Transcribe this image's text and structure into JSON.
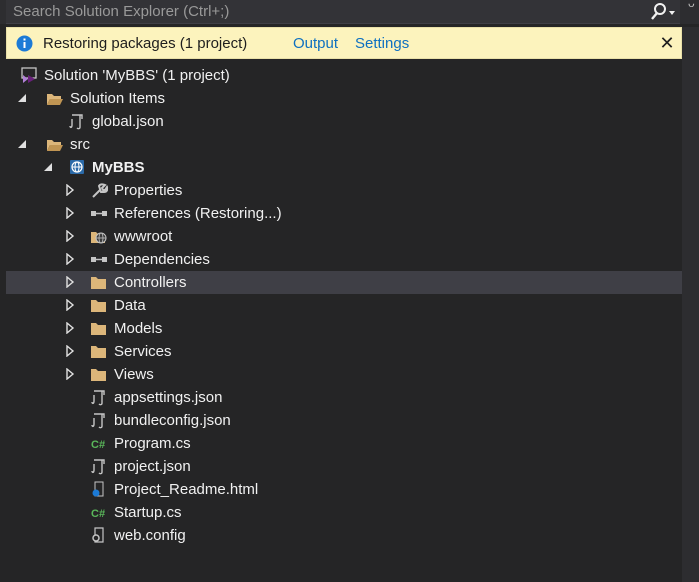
{
  "search": {
    "placeholder": "Search Solution Explorer (Ctrl+;)"
  },
  "infobar": {
    "message": "Restoring packages (1 project)",
    "links": [
      "Output",
      "Settings"
    ],
    "close": "✕"
  },
  "tree": [
    {
      "label": "Solution 'MyBBS' (1 project)",
      "icon": "solution-icon",
      "expander": "none"
    },
    {
      "label": "Solution Items",
      "icon": "folder-open-icon",
      "expander": "expanded"
    },
    {
      "label": "global.json",
      "icon": "json-file-icon",
      "expander": "none"
    },
    {
      "label": "src",
      "icon": "folder-open-icon",
      "expander": "expanded"
    },
    {
      "label": "MyBBS",
      "icon": "web-project-icon",
      "expander": "expanded",
      "bold": true
    },
    {
      "label": "Properties",
      "icon": "wrench-icon",
      "expander": "collapsed"
    },
    {
      "label": "References (Restoring...)",
      "icon": "references-icon",
      "expander": "collapsed"
    },
    {
      "label": "wwwroot",
      "icon": "globe-folder-icon",
      "expander": "collapsed"
    },
    {
      "label": "Dependencies",
      "icon": "references-icon",
      "expander": "collapsed"
    },
    {
      "label": "Controllers",
      "icon": "folder-icon",
      "expander": "collapsed",
      "selected": true
    },
    {
      "label": "Data",
      "icon": "folder-icon",
      "expander": "collapsed"
    },
    {
      "label": "Models",
      "icon": "folder-icon",
      "expander": "collapsed"
    },
    {
      "label": "Services",
      "icon": "folder-icon",
      "expander": "collapsed"
    },
    {
      "label": "Views",
      "icon": "folder-icon",
      "expander": "collapsed"
    },
    {
      "label": "appsettings.json",
      "icon": "json-file-icon",
      "expander": "none"
    },
    {
      "label": "bundleconfig.json",
      "icon": "json-file-icon",
      "expander": "none"
    },
    {
      "label": "Program.cs",
      "icon": "csharp-file-icon",
      "expander": "none"
    },
    {
      "label": "project.json",
      "icon": "json-file-icon",
      "expander": "none"
    },
    {
      "label": "Project_Readme.html",
      "icon": "html-file-icon",
      "expander": "none"
    },
    {
      "label": "Startup.cs",
      "icon": "csharp-file-icon",
      "expander": "none"
    },
    {
      "label": "web.config",
      "icon": "config-file-icon",
      "expander": "none"
    }
  ],
  "colors": {
    "background": "#252526",
    "selection": "#3f3f46",
    "infobar": "#fcf3bd",
    "link": "#0e70c0",
    "folder": "#dcb67a",
    "csharp": "#5ab75a"
  }
}
